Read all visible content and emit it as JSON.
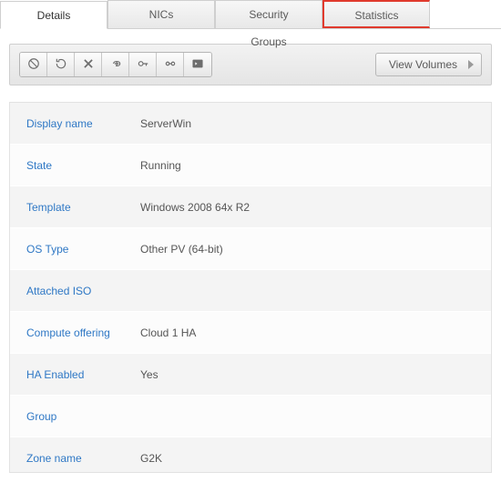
{
  "tabs": {
    "details": "Details",
    "nics": "NICs",
    "security_groups": "Security Groups",
    "statistics": "Statistics"
  },
  "toolbar": {
    "view_volumes": "View Volumes"
  },
  "details": [
    {
      "label": "Display name",
      "value": "ServerWin"
    },
    {
      "label": "State",
      "value": "Running"
    },
    {
      "label": "Template",
      "value": "Windows 2008 64x R2"
    },
    {
      "label": "OS Type",
      "value": "Other PV (64-bit)"
    },
    {
      "label": "Attached ISO",
      "value": ""
    },
    {
      "label": "Compute offering",
      "value": "Cloud 1 HA"
    },
    {
      "label": "HA Enabled",
      "value": "Yes"
    },
    {
      "label": "Group",
      "value": ""
    },
    {
      "label": "Zone name",
      "value": "G2K"
    }
  ]
}
